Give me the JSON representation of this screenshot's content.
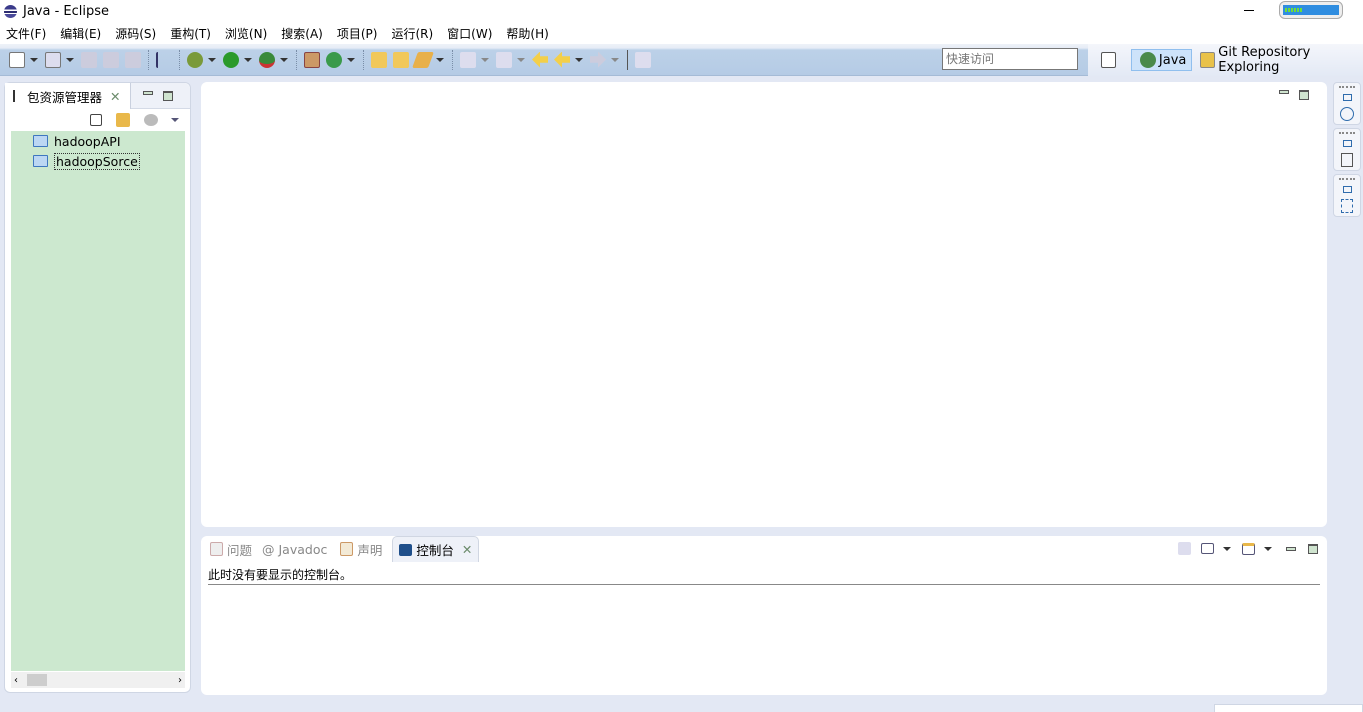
{
  "window": {
    "title": "Java  -  Eclipse"
  },
  "menu": [
    "文件(F)",
    "编辑(E)",
    "源码(S)",
    "重构(T)",
    "浏览(N)",
    "搜索(A)",
    "项目(P)",
    "运行(R)",
    "窗口(W)",
    "帮助(H)"
  ],
  "heap": {
    "used_fraction": 0.3
  },
  "quick_access": {
    "placeholder": "快速访问"
  },
  "perspectives": {
    "java": "Java",
    "git": "Git Repository Exploring"
  },
  "package_explorer": {
    "tab": "包资源管理器",
    "projects": [
      "hadoopAPI",
      "hadoopSorce"
    ]
  },
  "bottom_tabs": {
    "problems": "问题",
    "javadoc": "@ Javadoc",
    "declaration": "声明",
    "console": "控制台"
  },
  "console": {
    "message": "此时没有要显示的控制台。"
  }
}
